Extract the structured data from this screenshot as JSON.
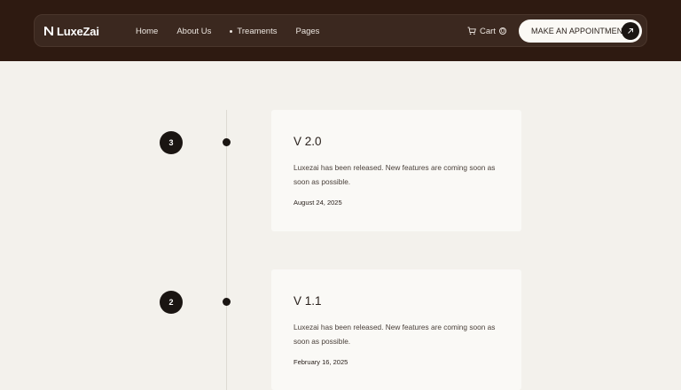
{
  "brand": {
    "name": "LuxeZai",
    "logo_icon": "n-monogram-icon"
  },
  "nav": {
    "links": [
      {
        "label": "Home"
      },
      {
        "label": "About Us"
      },
      {
        "label": "Treaments",
        "active": true
      },
      {
        "label": "Pages"
      }
    ],
    "cart_label": "Cart",
    "cart_count": "0",
    "cta_label": "MAKE AN APPOINTMENT"
  },
  "timeline": [
    {
      "number": "3",
      "title": "V 2.0",
      "description": "Luxezai has been released. New features are coming soon as soon as possible.",
      "date": "August 24, 2025"
    },
    {
      "number": "2",
      "title": "V 1.1",
      "description": "Luxezai has been released. New features are coming soon as soon as possible.",
      "date": "February 16, 2025"
    }
  ],
  "colors": {
    "header_bg": "#2e1a11",
    "navbar_bg": "#3b281f",
    "page_bg": "#f3f1ec",
    "card_bg": "#faf9f6",
    "accent_dark": "#1a1512"
  }
}
